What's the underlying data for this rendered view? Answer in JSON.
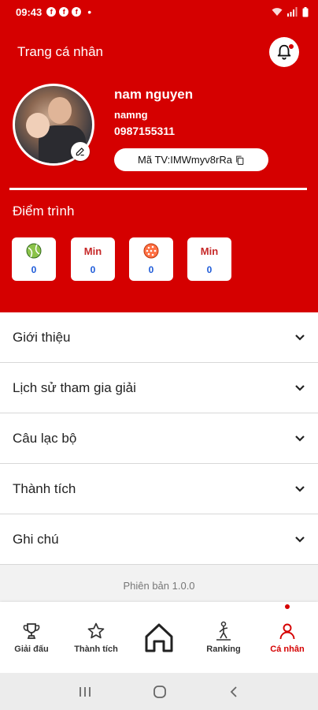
{
  "status_bar": {
    "time": "09:43",
    "fb_icons": [
      "f",
      "f",
      "f"
    ],
    "dot": "•"
  },
  "header": {
    "title": "Trang cá nhân",
    "user": {
      "name": "nam nguyen",
      "handle": "namng",
      "phone": "0987155311",
      "member_code": "Mã TV:IMWmyv8rRa"
    },
    "points_title": "Điểm trình",
    "stats": [
      {
        "top": "",
        "icon": "tennis-ball-icon",
        "value": "0"
      },
      {
        "top": "Min",
        "icon": "",
        "value": "0"
      },
      {
        "top": "",
        "icon": "pickleball-icon",
        "value": "0"
      },
      {
        "top": "Min",
        "icon": "",
        "value": "0"
      }
    ]
  },
  "sections": [
    {
      "label": "Giới thiệu"
    },
    {
      "label": "Lịch sử tham gia giải"
    },
    {
      "label": "Câu lạc bộ"
    },
    {
      "label": "Thành tích"
    },
    {
      "label": "Ghi chú"
    }
  ],
  "version": "Phiên bản 1.0.0",
  "bottom_nav": [
    {
      "label": "Giải đấu",
      "icon": "trophy-icon"
    },
    {
      "label": "Thành tích",
      "icon": "star-icon"
    },
    {
      "label": "",
      "icon": "home-icon"
    },
    {
      "label": "Ranking",
      "icon": "ranking-icon"
    },
    {
      "label": "Cá nhân",
      "icon": "person-icon",
      "active": true
    }
  ],
  "colors": {
    "brand": "#d50000",
    "stat_value": "#1e5bd8",
    "stat_min": "#c62828"
  }
}
